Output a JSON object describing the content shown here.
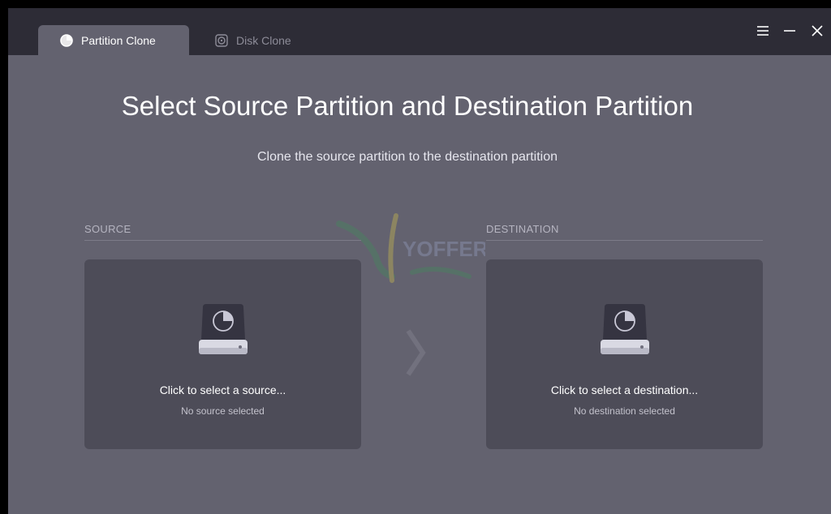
{
  "tabs": [
    {
      "label": "Partition Clone",
      "icon": "pie-chart-icon",
      "active": true
    },
    {
      "label": "Disk Clone",
      "icon": "disk-icon",
      "active": false
    }
  ],
  "window_controls": {
    "menu": "hamburger-menu-icon",
    "minimize": "minimize-icon",
    "close": "close-icon"
  },
  "main": {
    "title": "Select Source Partition and Destination Partition",
    "subtitle": "Clone the source partition to the destination partition"
  },
  "source": {
    "label": "SOURCE",
    "prompt": "Click to select a source...",
    "status": "No source selected"
  },
  "destination": {
    "label": "DESTINATION",
    "prompt": "Click to select a destination...",
    "status": "No destination selected"
  },
  "watermark_text": "YOFFERS",
  "colors": {
    "background": "#63626f",
    "titlebar": "#2d2c36",
    "panel": "#4d4c58",
    "accent": "#9aa0d8"
  }
}
